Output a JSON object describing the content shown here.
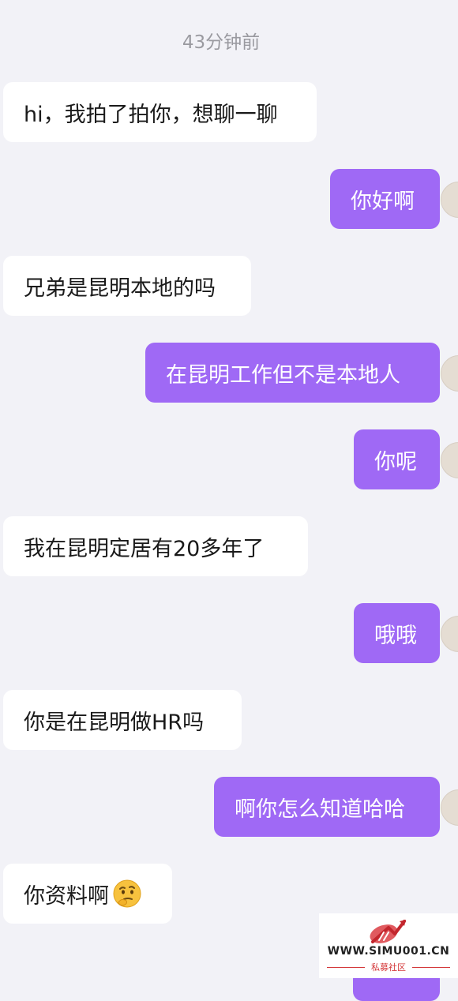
{
  "chat": {
    "timestamp": "43分钟前",
    "messages": [
      {
        "side": "incoming",
        "text": "hi，我拍了拍你，想聊一聊"
      },
      {
        "side": "outgoing",
        "text": "你好啊"
      },
      {
        "side": "incoming",
        "text": "兄弟是昆明本地的吗"
      },
      {
        "side": "outgoing",
        "text": "在昆明工作但不是本地人"
      },
      {
        "side": "outgoing",
        "text": "你呢"
      },
      {
        "side": "incoming",
        "text": "我在昆明定居有20多年了"
      },
      {
        "side": "outgoing",
        "text": "哦哦"
      },
      {
        "side": "incoming",
        "text": "你是在昆明做HR吗"
      },
      {
        "side": "outgoing",
        "text": "啊你怎么知道哈哈"
      },
      {
        "side": "incoming",
        "text": "你资料啊",
        "emoji": "thinking-face-icon"
      }
    ]
  },
  "watermark": {
    "url": "WWW.SIMU001.CN",
    "subtitle": "私募社区"
  },
  "colors": {
    "background": "#f2f2f7",
    "incoming_bubble": "#ffffff",
    "outgoing_bubble": "#9f69f5",
    "timestamp_text": "#9a9aa0"
  }
}
